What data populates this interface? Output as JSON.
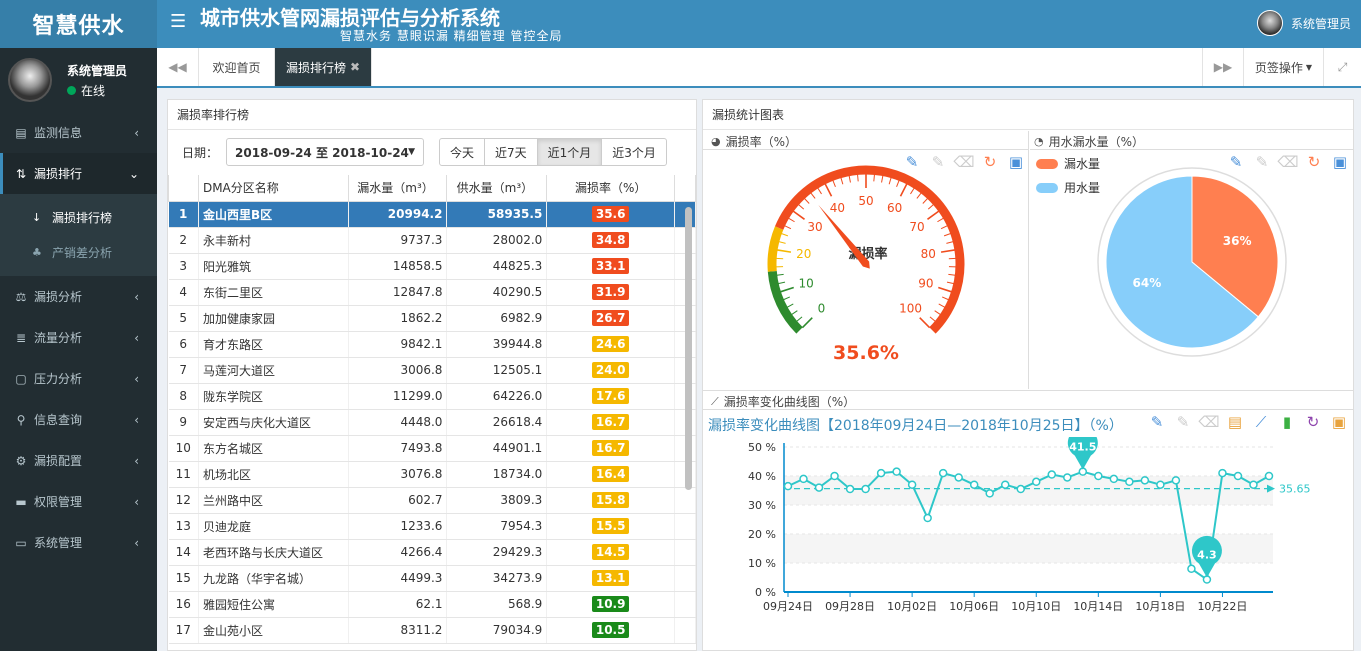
{
  "header": {
    "logo": "智慧供水",
    "menu_icon": "menu-icon",
    "title": "城市供水管网漏损评估与分析系统",
    "subtitle": "智慧水务  慧眼识漏  精细管理  管控全局",
    "user": "系统管理员"
  },
  "sidebar": {
    "user_name": "系统管理员",
    "status": "在线",
    "status_color": "#00a65a",
    "items": [
      {
        "label": "监测信息",
        "icon": "monitor-icon"
      },
      {
        "label": "漏损排行",
        "icon": "rank-icon"
      },
      {
        "label": "漏损分析",
        "icon": "balance-icon"
      },
      {
        "label": "流量分析",
        "icon": "list-icon"
      },
      {
        "label": "压力分析",
        "icon": "doc-icon"
      },
      {
        "label": "信息查询",
        "icon": "search-icon"
      },
      {
        "label": "漏损配置",
        "icon": "gears-icon"
      },
      {
        "label": "权限管理",
        "icon": "keyboard-icon"
      },
      {
        "label": "系统管理",
        "icon": "desktop-icon"
      }
    ],
    "sub_items": [
      {
        "label": "漏损排行榜",
        "icon": "sort-icon"
      },
      {
        "label": "产销差分析",
        "icon": "sitemap-icon"
      }
    ]
  },
  "tabs": {
    "home": "欢迎首页",
    "active": "漏损排行榜",
    "ops": "页签操作"
  },
  "ranking": {
    "title": "漏损率排行榜",
    "date_label": "日期：",
    "date_range": "2018-09-24 至 2018-10-24",
    "quick": [
      "今天",
      "近7天",
      "近1个月",
      "近3个月"
    ],
    "quick_active": 2,
    "columns": [
      "DMA分区名称",
      "漏水量（m³）",
      "供水量（m³）",
      "漏损率（%）"
    ],
    "rows": [
      {
        "idx": "1",
        "name": "金山西里B区",
        "leak": "20994.2",
        "supply": "58935.5",
        "rate": "35.6",
        "color": "#f04c1e"
      },
      {
        "idx": "2",
        "name": "永丰新村",
        "leak": "9737.3",
        "supply": "28002.0",
        "rate": "34.8",
        "color": "#f04c1e"
      },
      {
        "idx": "3",
        "name": "阳光雅筑",
        "leak": "14858.5",
        "supply": "44825.3",
        "rate": "33.1",
        "color": "#f04c1e"
      },
      {
        "idx": "4",
        "name": "东街二里区",
        "leak": "12847.8",
        "supply": "40290.5",
        "rate": "31.9",
        "color": "#f04c1e"
      },
      {
        "idx": "5",
        "name": "加加健康家园",
        "leak": "1862.2",
        "supply": "6982.9",
        "rate": "26.7",
        "color": "#f04c1e"
      },
      {
        "idx": "6",
        "name": "育才东路区",
        "leak": "9842.1",
        "supply": "39944.8",
        "rate": "24.6",
        "color": "#f5b800"
      },
      {
        "idx": "7",
        "name": "马莲河大道区",
        "leak": "3006.8",
        "supply": "12505.1",
        "rate": "24.0",
        "color": "#f5b800"
      },
      {
        "idx": "8",
        "name": "陇东学院区",
        "leak": "11299.0",
        "supply": "64226.0",
        "rate": "17.6",
        "color": "#f5b800"
      },
      {
        "idx": "9",
        "name": "安定西与庆化大道区",
        "leak": "4448.0",
        "supply": "26618.4",
        "rate": "16.7",
        "color": "#f5b800"
      },
      {
        "idx": "10",
        "name": "东方名城区",
        "leak": "7493.8",
        "supply": "44901.1",
        "rate": "16.7",
        "color": "#f5b800"
      },
      {
        "idx": "11",
        "name": "机场北区",
        "leak": "3076.8",
        "supply": "18734.0",
        "rate": "16.4",
        "color": "#f5b800"
      },
      {
        "idx": "12",
        "name": "兰州路中区",
        "leak": "602.7",
        "supply": "3809.3",
        "rate": "15.8",
        "color": "#f5b800"
      },
      {
        "idx": "13",
        "name": "贝迪龙庭",
        "leak": "1233.6",
        "supply": "7954.3",
        "rate": "15.5",
        "color": "#f5b800"
      },
      {
        "idx": "14",
        "name": "老西环路与长庆大道区",
        "leak": "4266.4",
        "supply": "29429.3",
        "rate": "14.5",
        "color": "#f5b800"
      },
      {
        "idx": "15",
        "name": "九龙路（华宇名城）",
        "leak": "4499.3",
        "supply": "34273.9",
        "rate": "13.1",
        "color": "#f5b800"
      },
      {
        "idx": "16",
        "name": "雅园短住公寓",
        "leak": "62.1",
        "supply": "568.9",
        "rate": "10.9",
        "color": "#1a8a1a"
      },
      {
        "idx": "17",
        "name": "金山苑小区",
        "leak": "8311.2",
        "supply": "79034.9",
        "rate": "10.5",
        "color": "#1a8a1a"
      }
    ]
  },
  "stats": {
    "title": "漏损统计图表",
    "gauge_header": "漏损率（%）",
    "pie_header": "用水漏水量（%）",
    "trend_header": "漏损率变化曲线图（%）"
  },
  "chart_data": [
    {
      "type": "gauge",
      "name": "漏损率",
      "value": 35.6,
      "value_label": "35.6%",
      "min": 0,
      "max": 100,
      "ticks": [
        "0",
        "10",
        "20",
        "30",
        "40",
        "50",
        "60",
        "70",
        "80",
        "90",
        "100"
      ],
      "bands": [
        {
          "to": 15,
          "color": "#2e8b2e"
        },
        {
          "to": 25,
          "color": "#f5b800"
        },
        {
          "to": 100,
          "color": "#f04c1e"
        }
      ]
    },
    {
      "type": "pie",
      "legend": [
        "漏水量",
        "用水量"
      ],
      "slices": [
        {
          "name": "漏水量",
          "value": 36,
          "label": "36%",
          "color": "#ff7f50"
        },
        {
          "name": "用水量",
          "value": 64,
          "label": "64%",
          "color": "#87cefa"
        }
      ]
    },
    {
      "type": "line",
      "title": "漏损率变化曲线图【2018年09月24日—2018年10月25日】（%）",
      "x_labels": [
        "09月24日",
        "09月28日",
        "10月02日",
        "10月06日",
        "10月10日",
        "10月14日",
        "10月18日",
        "10月22日"
      ],
      "y_ticks": [
        "0 %",
        "10 %",
        "20 %",
        "30 %",
        "40 %",
        "50 %"
      ],
      "ylim": [
        0,
        50
      ],
      "values": [
        36.5,
        39,
        36,
        40,
        35.5,
        35.5,
        41,
        41.5,
        37,
        25.5,
        41,
        39.5,
        37,
        34,
        37,
        35.5,
        38,
        40.5,
        39.5,
        41.5,
        40,
        39,
        38,
        38.5,
        37,
        38.5,
        8,
        4.3,
        41,
        40,
        37,
        40
      ],
      "max_marker": {
        "label": "41.5",
        "index": 19
      },
      "min_marker": {
        "label": "4.3",
        "index": 27
      },
      "average": 35.65,
      "average_label": "35.65",
      "color": "#2ec7c9"
    }
  ]
}
